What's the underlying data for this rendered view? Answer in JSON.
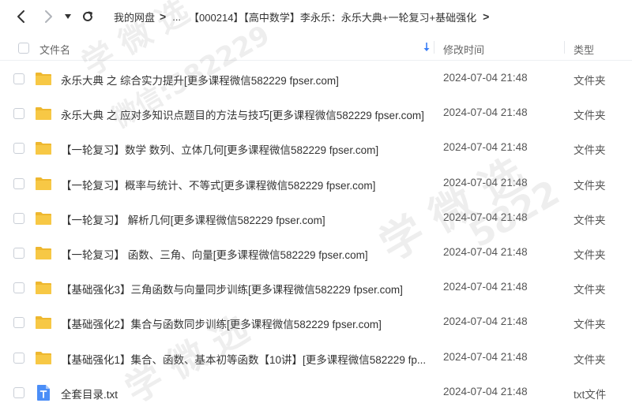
{
  "nav": {
    "back_icon": "chevron-left-icon",
    "forward_icon": "chevron-right-icon",
    "history_icon": "caret-down-icon",
    "refresh_icon": "refresh-icon"
  },
  "breadcrumb": {
    "root": "我的网盘",
    "sep": ">",
    "ellipsis": "...",
    "current": "【000214】【高中数学】李永乐：永乐大典+一轮复习+基础强化",
    "trail": ">"
  },
  "columns": {
    "name": "文件名",
    "time": "修改时间",
    "type": "类型"
  },
  "files": [
    {
      "name": "永乐大典 之 综合实力提升[更多课程微信582229 fpser.com]",
      "time": "2024-07-04 21:48",
      "type": "文件夹",
      "icon": "folder-icon"
    },
    {
      "name": "永乐大典 之 应对多知识点题目的方法与技巧[更多课程微信582229 fpser.com]",
      "time": "2024-07-04 21:48",
      "type": "文件夹",
      "icon": "folder-icon"
    },
    {
      "name": "【一轮复习】数学 数列、立体几何[更多课程微信582229 fpser.com]",
      "time": "2024-07-04 21:48",
      "type": "文件夹",
      "icon": "folder-icon"
    },
    {
      "name": "【一轮复习】概率与统计、不等式[更多课程微信582229 fpser.com]",
      "time": "2024-07-04 21:48",
      "type": "文件夹",
      "icon": "folder-icon"
    },
    {
      "name": "【一轮复习】 解析几何[更多课程微信582229 fpser.com]",
      "time": "2024-07-04 21:48",
      "type": "文件夹",
      "icon": "folder-icon"
    },
    {
      "name": "【一轮复习】 函数、三角、向量[更多课程微信582229 fpser.com]",
      "time": "2024-07-04 21:48",
      "type": "文件夹",
      "icon": "folder-icon"
    },
    {
      "name": "【基础强化3】三角函数与向量同步训练[更多课程微信582229 fpser.com]",
      "time": "2024-07-04 21:48",
      "type": "文件夹",
      "icon": "folder-icon"
    },
    {
      "name": "【基础强化2】集合与函数同步训练[更多课程微信582229 fpser.com]",
      "time": "2024-07-04 21:48",
      "type": "文件夹",
      "icon": "folder-icon"
    },
    {
      "name": "【基础强化1】集合、函数、基本初等函数【10讲】[更多课程微信582229 fp...",
      "time": "2024-07-04 21:48",
      "type": "文件夹",
      "icon": "folder-icon"
    },
    {
      "name": "全套目录.txt",
      "time": "2024-07-04 21:48",
      "type": "txt文件",
      "icon": "txt-file-icon"
    }
  ],
  "watermark": {
    "line1": "学 微 选",
    "line2": "微信:582229",
    "line3": "学 微 选",
    "line4": "5822"
  },
  "colors": {
    "folder": "#f7c845",
    "folder_dark": "#eeb72f",
    "txt": "#4b8ef7",
    "accent": "#3a7ef7"
  }
}
